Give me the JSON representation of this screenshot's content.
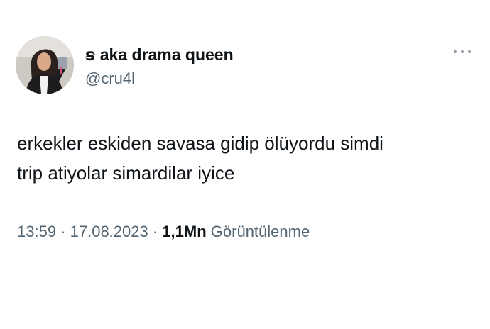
{
  "user": {
    "display_name_prefix": "ꞩ",
    "display_name": "aka drama queen",
    "handle": "@cru4l"
  },
  "tweet": {
    "lines": [
      "erkekler eskiden savasa gidip ölüyordu simdi",
      "trip atiyolar simardilar iyice"
    ]
  },
  "meta": {
    "time": "13:59",
    "separator1": " · ",
    "date": "17.08.2023",
    "separator2": " · ",
    "views_count": "1,1Mn",
    "views_label": "Görüntülenme"
  },
  "icons": {
    "more": "more-options-icon",
    "avatar": "profile-photo"
  },
  "colors": {
    "text_primary": "#0f1419",
    "text_secondary": "#536471",
    "background": "#ffffff"
  }
}
